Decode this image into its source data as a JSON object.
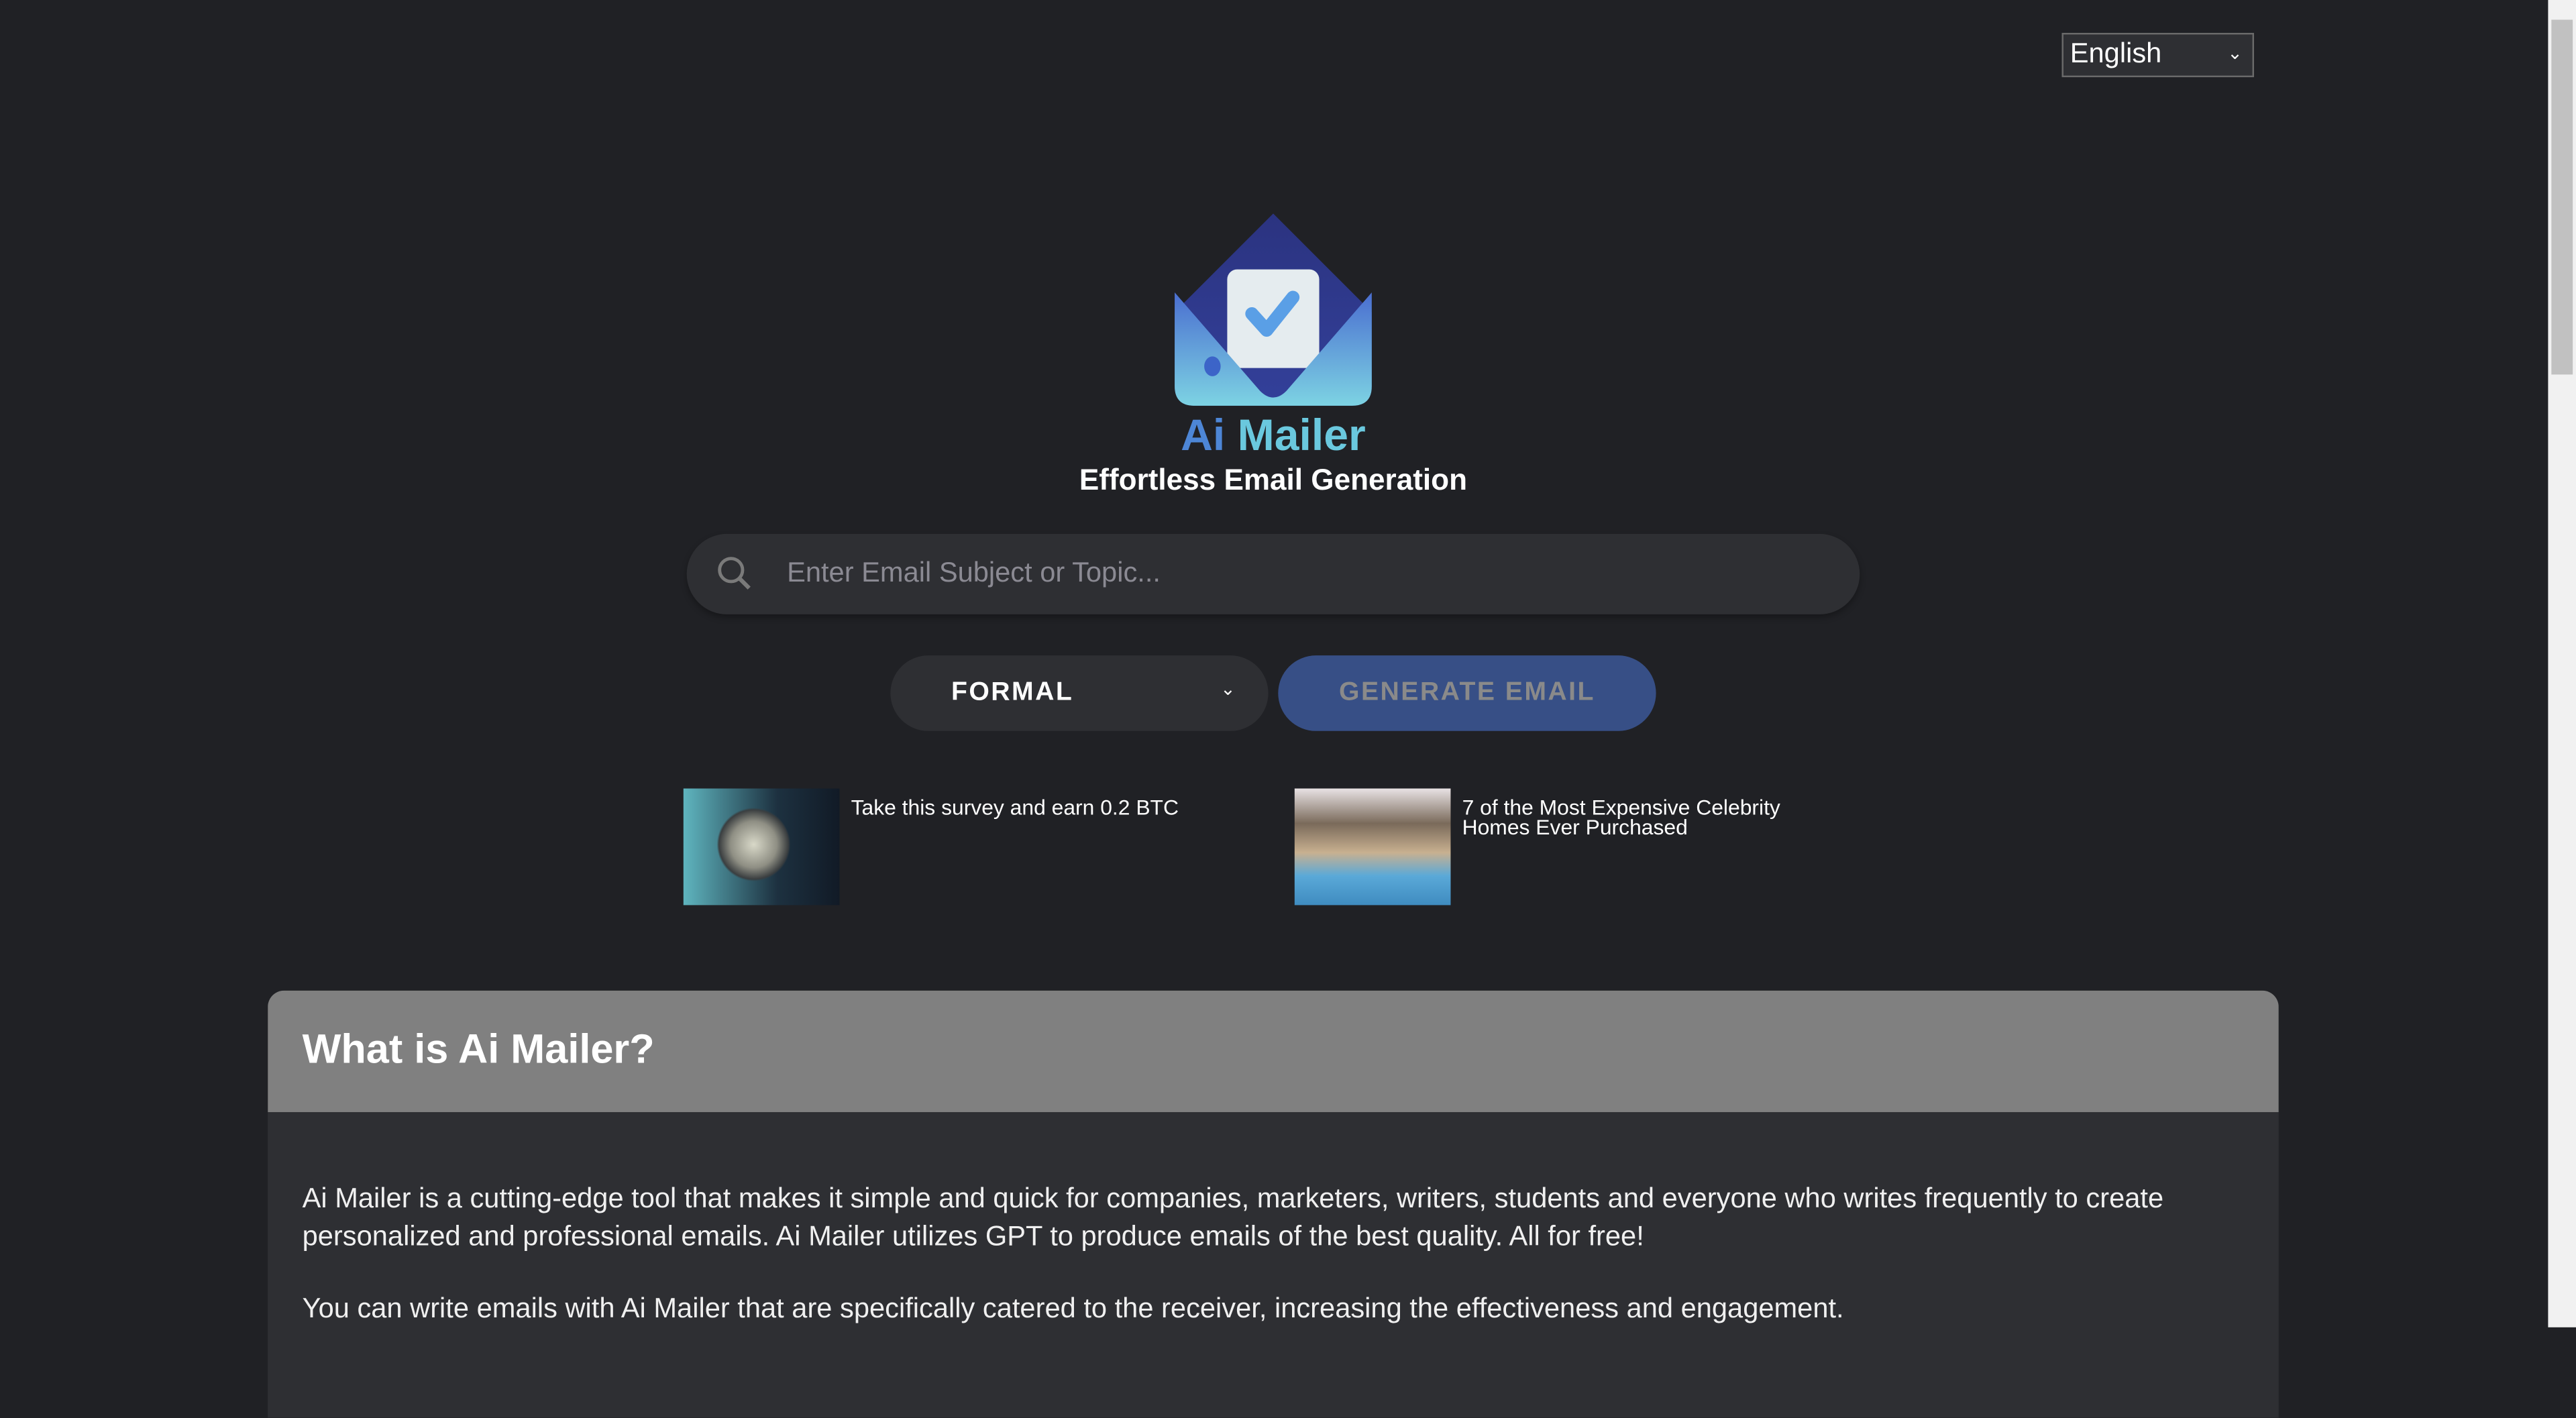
{
  "language_select": {
    "value": "English"
  },
  "brand": {
    "name_part1": "Ai",
    "name_part2": "Mailer",
    "tagline": "Effortless Email Generation"
  },
  "search": {
    "placeholder": "Enter Email Subject or Topic...",
    "value": ""
  },
  "tone_select": {
    "value": "FORMAL"
  },
  "generate_button": {
    "label": "GENERATE EMAIL"
  },
  "ads": [
    {
      "title": "Take this survey and earn 0.2 BTC"
    },
    {
      "title": "7 of the Most Expensive Celebrity Homes Ever Purchased"
    }
  ],
  "about": {
    "title": "What is Ai Mailer?",
    "paragraphs": [
      "Ai Mailer is a cutting-edge tool that makes it simple and quick for companies, marketers, writers, students and everyone who writes frequently to create personalized and professional emails. Ai Mailer utilizes GPT to produce emails of the best quality. All for free!",
      "You can write emails with Ai Mailer that are specifically catered to the receiver, increasing the effectiveness and engagement."
    ]
  },
  "colors": {
    "background": "#202125",
    "panel": "#2e2f33",
    "accent": "#374f86",
    "card_header": "#808080"
  }
}
